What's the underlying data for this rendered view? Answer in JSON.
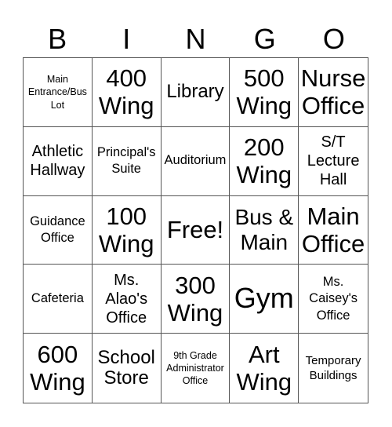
{
  "header": [
    "B",
    "I",
    "N",
    "G",
    "O"
  ],
  "cells": [
    "Main\nEntrance/Bus\nLot",
    "400\nWing",
    "Library",
    "500\nWing",
    "Nurse\nOffice",
    "Athletic\nHallway",
    "Principal's\nSuite",
    "Auditorium",
    "200\nWing",
    "S/T\nLecture\nHall",
    "Guidance\nOffice",
    "100\nWing",
    "Free!",
    "Bus &\nMain",
    "Main\nOffice",
    "Cafeteria",
    "Ms.\nAlao's\nOffice",
    "300\nWing",
    "Gym",
    "Ms.\nCaisey's\nOffice",
    "600\nWing",
    "School\nStore",
    "9th Grade\nAdministrator\nOffice",
    "Art\nWing",
    "Temporary\nBuildings"
  ]
}
